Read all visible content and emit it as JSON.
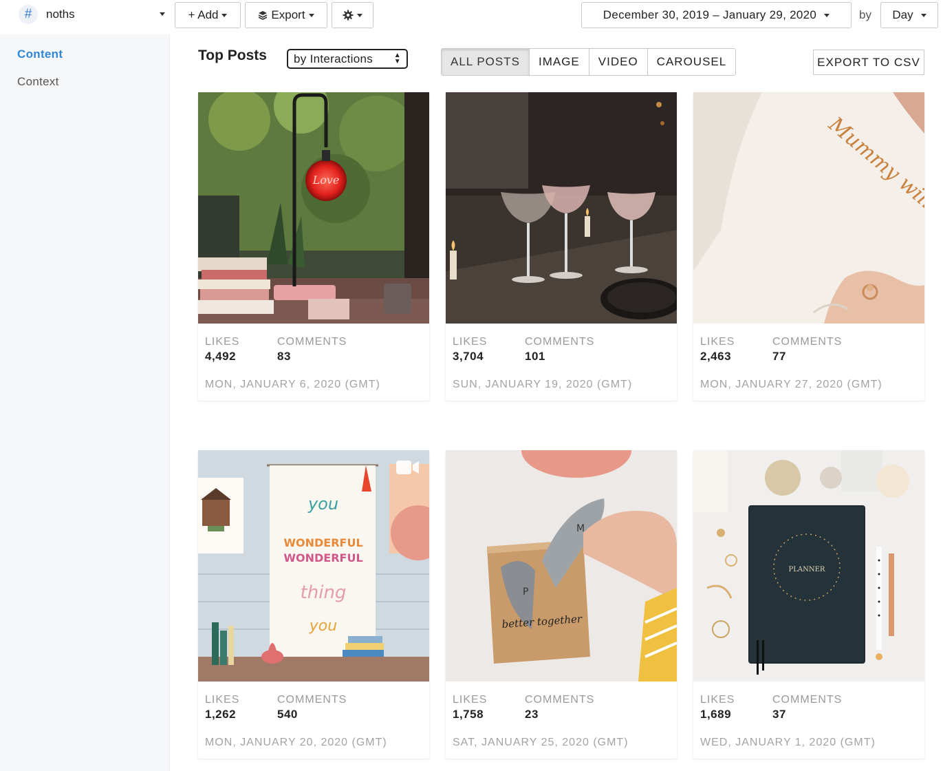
{
  "toolbar": {
    "account_name": "noths",
    "add_label": "+ Add",
    "export_label": "Export",
    "date_range": "December 30, 2019 – January 29, 2020",
    "by_label": "by",
    "interval": "Day"
  },
  "sidebar": {
    "items": [
      {
        "label": "Content",
        "active": true
      },
      {
        "label": "Context",
        "active": false
      }
    ]
  },
  "main": {
    "title": "Top Posts",
    "sort_value": "by Interactions",
    "filters": [
      "ALL POSTS",
      "IMAGE",
      "VIDEO",
      "CAROUSEL"
    ],
    "active_filter": "ALL POSTS",
    "export_csv": "EXPORT TO CSV",
    "likes_label": "LIKES",
    "comments_label": "COMMENTS"
  },
  "posts": [
    {
      "likes": "4,492",
      "comments": "83",
      "date": "MON, JANUARY 6, 2020 (GMT)",
      "type": "image"
    },
    {
      "likes": "3,704",
      "comments": "101",
      "date": "SUN, JANUARY 19, 2020 (GMT)",
      "type": "image"
    },
    {
      "likes": "2,463",
      "comments": "77",
      "date": "MON, JANUARY 27, 2020 (GMT)",
      "type": "image"
    },
    {
      "likes": "1,262",
      "comments": "540",
      "date": "MON, JANUARY 20, 2020 (GMT)",
      "type": "video"
    },
    {
      "likes": "1,758",
      "comments": "23",
      "date": "SAT, JANUARY 25, 2020 (GMT)",
      "type": "image"
    },
    {
      "likes": "1,689",
      "comments": "37",
      "date": "WED, JANUARY 1, 2020 (GMT)",
      "type": "image"
    }
  ],
  "image_text": {
    "lamp": "Love",
    "onesie": "Mummy will you marry my Daddy?",
    "banner": [
      "you",
      "WONDERFUL",
      "WONDERFUL",
      "thing",
      "you"
    ],
    "hearts_left": "P",
    "hearts_right": "M",
    "wood_block": "better together",
    "planner": "PLANNER"
  },
  "colors": {
    "accent": "#2f86d6",
    "muted_label": "#9a9a9a"
  }
}
